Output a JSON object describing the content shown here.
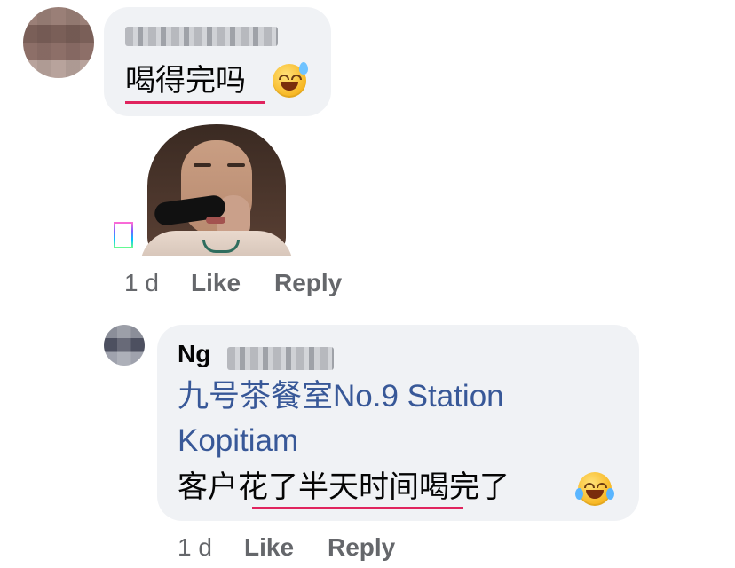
{
  "comment1": {
    "text": "喝得完吗",
    "emoji": "sweat-smile-emoji",
    "time": "1 d",
    "like_label": "Like",
    "reply_label": "Reply"
  },
  "reply1": {
    "author_visible": "Ng",
    "link_text": "九号茶餐室No.9 Station Kopitiam",
    "text": "客户花了半天时间喝完了",
    "emoji": "tears-of-joy-emoji",
    "time": "1 d",
    "like_label": "Like",
    "reply_label": "Reply"
  },
  "colors": {
    "bubble_bg": "#f0f2f5",
    "link_blue": "#385898",
    "meta_gray": "#65676b",
    "underline_red": "#e0245e"
  }
}
